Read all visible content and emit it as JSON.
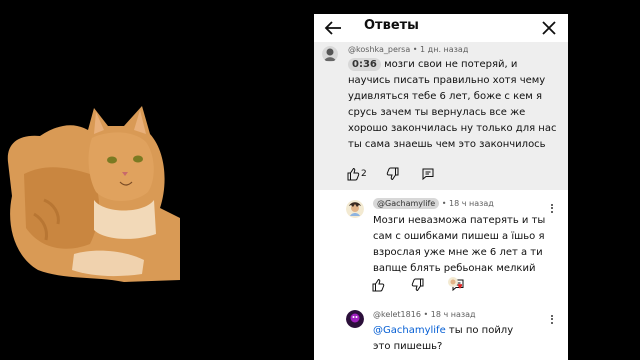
{
  "header": {
    "title": "Ответы",
    "back_icon": "arrow-left-icon",
    "close_icon": "close-icon"
  },
  "main_comment": {
    "author": "@koshka_persa",
    "time": "1 дн. назад",
    "timestamp": "0:36",
    "text": "мозги свои не потеряй, и научись писать правильно хотя чему удивляться тебе 6 лет, боже с кем я срусь зачем ты вернулась все же хорошо закончилась ну только для нас ты сама знаешь чем это закончилось",
    "likes": "2"
  },
  "reply1": {
    "author": "@Gachamylife",
    "time": "18 ч назад",
    "text": "Мозги невазможа патерять и ты сам с ошибками пишеш а їшьо я взрослая уже мне же 6 лет а ти вапще блять ребьонак мелкий"
  },
  "reply2": {
    "author": "@kelet1816",
    "time": "18 ч назад",
    "mention": "@Gachamylife",
    "text": "ты по пойлу это пишешь?"
  },
  "colors": {
    "link": "#065fd4",
    "highlight_bg": "#eeeeee"
  }
}
